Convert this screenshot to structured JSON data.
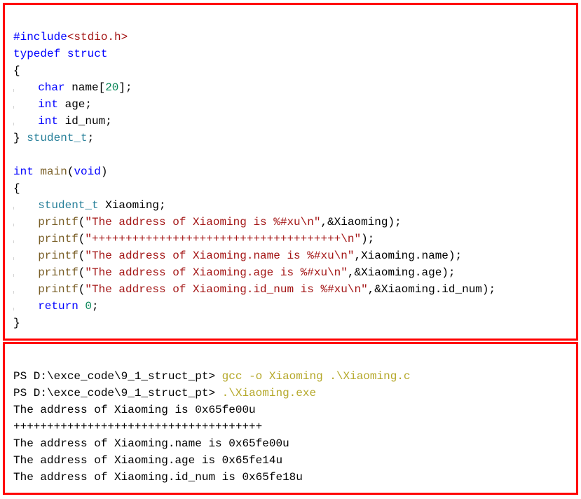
{
  "code": {
    "l1_include_kw": "#include",
    "l1_include_hdr": "<stdio.h>",
    "l2_typedef": "typedef",
    "l2_struct": "struct",
    "l3_brace": "{",
    "l4_char": "char",
    "l4_name": " name[",
    "l4_20": "20",
    "l4_close": "];",
    "l5_int": "int",
    "l5_age": " age;",
    "l6_int": "int",
    "l6_id": " id_num;",
    "l7_close": "} ",
    "l7_type": "student_t",
    "l7_semi": ";",
    "l9_int": "int",
    "l9_main": " main",
    "l9_void": "void",
    "l10_brace": "{",
    "l11_type": "student_t",
    "l11_var": " Xiaoming;",
    "l12_fn": "printf",
    "l12_str": "\"The address of Xiaoming is %#xu\\n\"",
    "l12_arg": ",&Xiaoming);",
    "l13_fn": "printf",
    "l13_str": "\"+++++++++++++++++++++++++++++++++++++\\n\"",
    "l13_end": ");",
    "l14_fn": "printf",
    "l14_str": "\"The address of Xiaoming.name is %#xu\\n\"",
    "l14_arg": ",Xiaoming.name);",
    "l15_fn": "printf",
    "l15_str": "\"The address of Xiaoming.age is %#xu\\n\"",
    "l15_arg": ",&Xiaoming.age);",
    "l16_fn": "printf",
    "l16_str": "\"The address of Xiaoming.id_num is %#xu\\n\"",
    "l16_arg": ",&Xiaoming.id_num);",
    "l17_return": "return",
    "l17_zero": " 0",
    "l17_semi": ";",
    "l18_brace": "}"
  },
  "terminal": {
    "p1_prompt": "PS D:\\exce_code\\9_1_struct_pt> ",
    "p1_cmd": "gcc -o Xiaoming .\\Xiaoming.c",
    "p2_prompt": "PS D:\\exce_code\\9_1_struct_pt> ",
    "p2_cmd": ".\\Xiaoming.exe",
    "o1": "The address of Xiaoming is 0x65fe00u",
    "o2": "+++++++++++++++++++++++++++++++++++++",
    "o3": "The address of Xiaoming.name is 0x65fe00u",
    "o4": "The address of Xiaoming.age is 0x65fe14u",
    "o5": "The address of Xiaoming.id_num is 0x65fe18u"
  }
}
